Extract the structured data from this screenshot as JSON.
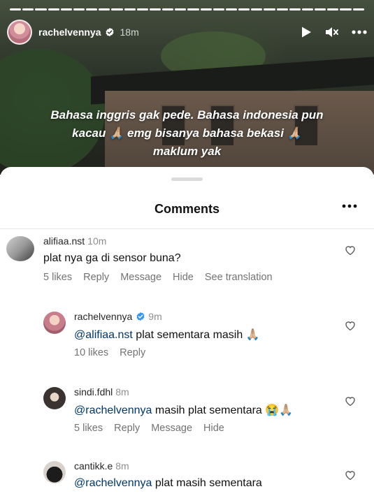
{
  "story": {
    "username": "rachelvennya",
    "time": "18m",
    "caption_lines": [
      "Bahasa inggris gak pede. Bahasa indonesia pun",
      "kacau 🙏🏼 emg bisanya bahasa bekasi 🙏🏼",
      "maklum yak"
    ],
    "progress_segments": 28,
    "progress_done": 28
  },
  "sheet": {
    "title": "Comments"
  },
  "comments": [
    {
      "username": "alifiaa.nst",
      "time": "10m",
      "mention": "",
      "text": "plat nya ga di sensor buna?",
      "likes": "5 likes",
      "actions": [
        "Reply",
        "Message",
        "Hide",
        "See translation"
      ]
    },
    {
      "username": "rachelvennya",
      "verified": true,
      "time": "9m",
      "mention": "@alifiaa.nst",
      "text": " plat sementara masih 🙏🏼",
      "likes": "10 likes",
      "actions": [
        "Reply"
      ]
    },
    {
      "username": "sindi.fdhl",
      "time": "8m",
      "mention": "@rachelvennya",
      "text": " masih plat sementara 😭🙏🏼",
      "likes": "5 likes",
      "actions": [
        "Reply",
        "Message",
        "Hide"
      ]
    },
    {
      "username": "cantikk.e",
      "time": "8m",
      "mention": "@rachelvennya",
      "text": " plat masih sementara",
      "likes": "",
      "actions": []
    }
  ],
  "icons": {
    "play": "play-icon",
    "mute": "mute-icon",
    "more": "more-icon",
    "heart": "heart-icon",
    "verified": "verified-icon"
  },
  "colors": {
    "verified": "#3897f0",
    "mention": "#00376b",
    "meta": "#737373"
  }
}
